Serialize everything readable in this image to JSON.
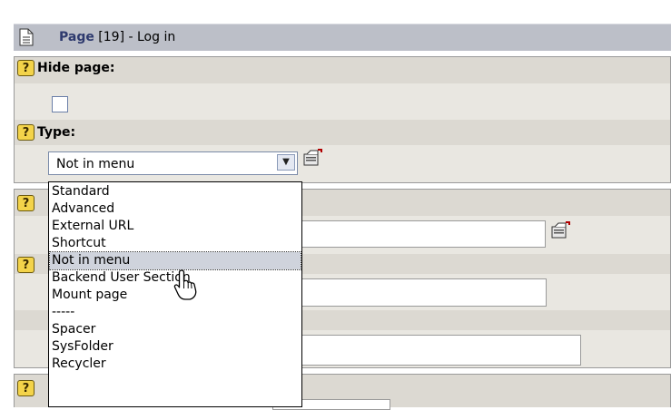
{
  "header": {
    "title_bold": "Page",
    "title_rest": " [19] - Log in"
  },
  "hide_page": {
    "label": "Hide page:",
    "checked": false
  },
  "type": {
    "label": "Type:",
    "selected": "Not in menu",
    "options": [
      "Standard",
      "Advanced",
      "External URL",
      "Shortcut",
      "Not in menu",
      "Backend User Section",
      "Mount page",
      "-----",
      "Spacer",
      "SysFolder",
      "Recycler"
    ]
  },
  "icons": {
    "help": "?",
    "dropdown_arrow": "▼"
  },
  "colors": {
    "header_bg": "#bcbfc8",
    "band_dark": "#dcd9d2",
    "band_light": "#e9e7e1",
    "help_icon": "#f3d34a",
    "selected_option": "#cfd3dc",
    "title_link": "#2e3a6e"
  }
}
